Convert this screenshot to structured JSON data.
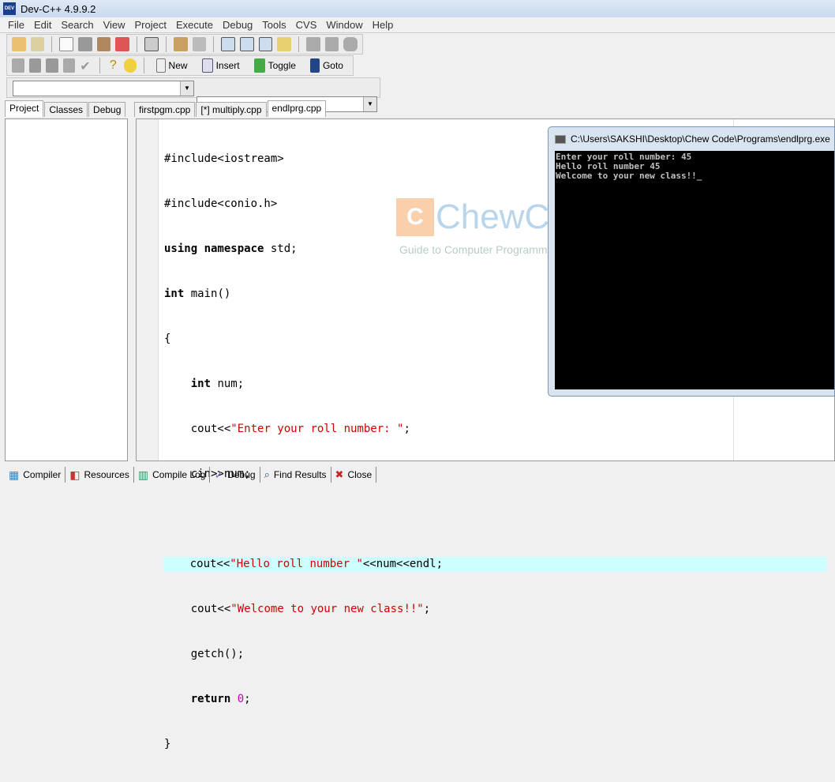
{
  "window": {
    "title": "Dev-C++ 4.9.9.2",
    "icon": "devcpp-icon"
  },
  "menu": [
    "File",
    "Edit",
    "Search",
    "View",
    "Project",
    "Execute",
    "Debug",
    "Tools",
    "CVS",
    "Window",
    "Help"
  ],
  "toolbar2": {
    "new": "New",
    "insert": "Insert",
    "toggle": "Toggle",
    "goto": "Goto"
  },
  "left_tabs": [
    "Project",
    "Classes",
    "Debug"
  ],
  "file_tabs": [
    "firstpgm.cpp",
    "[*] multiply.cpp",
    "endlprg.cpp"
  ],
  "active_file_tab": 2,
  "code": {
    "l1": "#include<iostream>",
    "l2": "#include<conio.h>",
    "l3a": "using namespace",
    "l3b": " std;",
    "l4a": "int",
    "l4b": " main()",
    "l5": "{",
    "l6a": "    int",
    "l6b": " num;",
    "l7a": "    cout<<",
    "l7b": "\"Enter your roll number: \"",
    "l7c": ";",
    "l8": "    cin>>num;",
    "l10a": "    cout<<",
    "l10b": "\"Hello roll number \"",
    "l10c": "<<num<<endl;",
    "l11a": "    cout<<",
    "l11b": "\"Welcome to your new class!!\"",
    "l11c": ";",
    "l12": "    getch();",
    "l13a": "    return",
    "l13b": " ",
    "l13c": "0",
    "l13d": ";",
    "l14": "}"
  },
  "console": {
    "title": "C:\\Users\\SAKSHI\\Desktop\\Chew Code\\Programs\\endlprg.exe",
    "output": "Enter your roll number: 45\nHello roll number 45\nWelcome to your new class!!_"
  },
  "watermark": {
    "logo": "ChewCode",
    "tagline": "Guide to Computer Programming Basics"
  },
  "bottom_tabs": [
    "Compiler",
    "Resources",
    "Compile Log",
    "Debug",
    "Find Results",
    "Close"
  ],
  "colors": {
    "string": "#d00000",
    "number": "#c000c0",
    "highlight": "#ccffff"
  }
}
